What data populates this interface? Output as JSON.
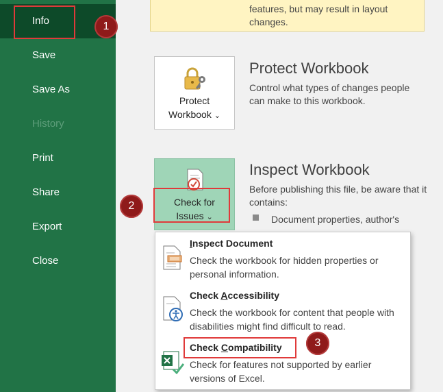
{
  "sidebar": {
    "items": [
      {
        "label": "Info",
        "active": true
      },
      {
        "label": "Save"
      },
      {
        "label": "Save As"
      },
      {
        "label": "History",
        "disabled": true
      },
      {
        "label": "Print"
      },
      {
        "label": "Share"
      },
      {
        "label": "Export"
      },
      {
        "label": "Close"
      }
    ]
  },
  "compat_note": {
    "line1": "features, but may result in layout",
    "line2": "changes."
  },
  "protect": {
    "button_line1": "Protect",
    "button_line2": "Workbook",
    "chevron": "⌄",
    "title": "Protect Workbook",
    "description": "Control what types of changes people can make to this workbook."
  },
  "inspect": {
    "button_line1": "Check for",
    "button_line2": "Issues",
    "chevron": "⌄",
    "title": "Inspect Workbook",
    "description": "Before publishing this file, be aware that it contains:",
    "bullet": "Document properties, author's"
  },
  "dropdown": {
    "items": [
      {
        "pre": "",
        "ul": "I",
        "post": "nspect Document",
        "desc": "Check the workbook for hidden properties or personal information.",
        "icon": "inspect-document-icon"
      },
      {
        "pre": "Check ",
        "ul": "A",
        "post": "ccessibility",
        "desc": "Check the workbook for content that people with disabilities might find difficult to read.",
        "icon": "accessibility-icon"
      },
      {
        "pre": "Check ",
        "ul": "C",
        "post": "ompatibility",
        "desc": "Check for features not supported by earlier versions of Excel.",
        "icon": "excel-compatibility-icon"
      }
    ]
  },
  "annotations": {
    "step1": "1",
    "step2": "2",
    "step3": "3"
  },
  "colors": {
    "sidebar": "#217346",
    "sidebar_active": "#0d4a29",
    "highlight_button": "#9fd5b7",
    "annotation_red": "#e03a3a",
    "badge": "#8f1a1a"
  }
}
